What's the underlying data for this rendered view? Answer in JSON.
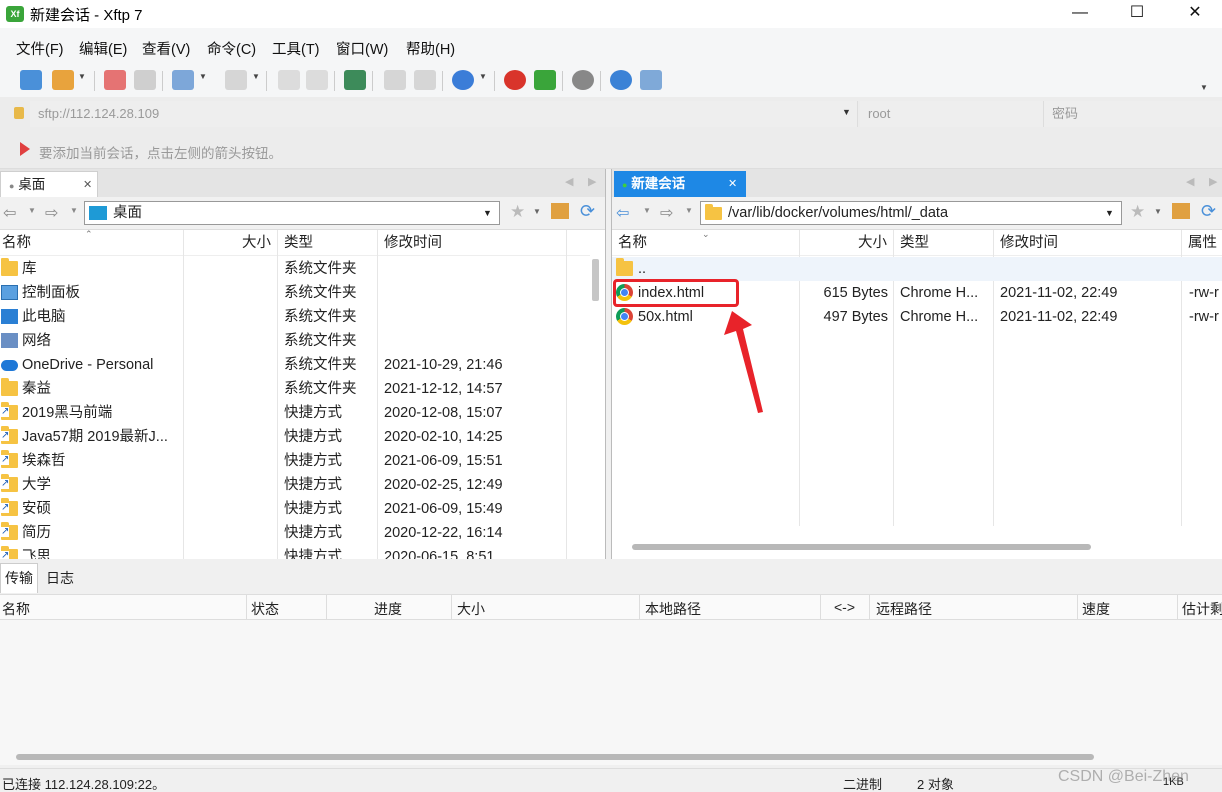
{
  "window": {
    "title": "新建会话 - Xftp 7",
    "app_icon_text": "Xf",
    "min_glyph": "—",
    "max_glyph": "☐",
    "close_glyph": "✕"
  },
  "menu": [
    {
      "label": "文件(F)"
    },
    {
      "label": "编辑(E)"
    },
    {
      "label": "查看(V)"
    },
    {
      "label": "命令(C)"
    },
    {
      "label": "工具(T)"
    },
    {
      "label": "窗口(W)"
    },
    {
      "label": "帮助(H)"
    }
  ],
  "address": {
    "host_placeholder": "sftp://112.124.28.109",
    "user_placeholder": "root",
    "password_placeholder": "密码"
  },
  "hint": "要添加当前会话，点击左侧的箭头按钮。",
  "left_pane": {
    "tab_label": "桌面",
    "path": "桌面",
    "columns": {
      "name": "名称",
      "size": "大小",
      "type": "类型",
      "modified": "修改时间"
    },
    "rows": [
      {
        "name": "库",
        "size": "",
        "type": "系统文件夹",
        "modified": "",
        "icon": "library-folder-icon"
      },
      {
        "name": "控制面板",
        "size": "",
        "type": "系统文件夹",
        "modified": "",
        "icon": "control-panel-icon"
      },
      {
        "name": "此电脑",
        "size": "",
        "type": "系统文件夹",
        "modified": "",
        "icon": "computer-icon"
      },
      {
        "name": "网络",
        "size": "",
        "type": "系统文件夹",
        "modified": "",
        "icon": "network-icon"
      },
      {
        "name": "OneDrive - Personal",
        "size": "",
        "type": "系统文件夹",
        "modified": "2021-10-29, 21:46",
        "icon": "onedrive-cloud-icon"
      },
      {
        "name": "秦益",
        "size": "",
        "type": "系统文件夹",
        "modified": "2021-12-12, 14:57",
        "icon": "folder-icon"
      },
      {
        "name": "2019黑马前端",
        "size": "",
        "type": "快捷方式",
        "modified": "2020-12-08, 15:07",
        "icon": "shortcut-folder-icon"
      },
      {
        "name": "Java57期 2019最新J...",
        "size": "",
        "type": "快捷方式",
        "modified": "2020-02-10, 14:25",
        "icon": "shortcut-folder-icon"
      },
      {
        "name": "埃森哲",
        "size": "",
        "type": "快捷方式",
        "modified": "2021-06-09, 15:51",
        "icon": "shortcut-folder-icon"
      },
      {
        "name": "大学",
        "size": "",
        "type": "快捷方式",
        "modified": "2020-02-25, 12:49",
        "icon": "shortcut-folder-icon"
      },
      {
        "name": "安硕",
        "size": "",
        "type": "快捷方式",
        "modified": "2021-06-09, 15:49",
        "icon": "shortcut-folder-icon"
      },
      {
        "name": "简历",
        "size": "",
        "type": "快捷方式",
        "modified": "2020-12-22, 16:14",
        "icon": "shortcut-folder-icon"
      },
      {
        "name": "飞思",
        "size": "",
        "type": "快捷方式",
        "modified": "2020-06-15, 8:51",
        "icon": "shortcut-folder-icon"
      }
    ]
  },
  "right_pane": {
    "tab_label": "新建会话",
    "path": "/var/lib/docker/volumes/html/_data",
    "columns": {
      "name": "名称",
      "size": "大小",
      "type": "类型",
      "modified": "修改时间",
      "attr": "属性"
    },
    "rows": [
      {
        "name": "..",
        "size": "",
        "type": "",
        "modified": "",
        "attr": "",
        "icon": "parent-folder-icon"
      },
      {
        "name": "index.html",
        "size": "615 Bytes",
        "type": "Chrome H...",
        "modified": "2021-11-02, 22:49",
        "attr": "-rw-r",
        "icon": "chrome-html-icon",
        "highlighted": true
      },
      {
        "name": "50x.html",
        "size": "497 Bytes",
        "type": "Chrome H...",
        "modified": "2021-11-02, 22:49",
        "attr": "-rw-r",
        "icon": "chrome-html-icon"
      }
    ],
    "annotation_color": "#e8232a"
  },
  "bottom": {
    "tabs": [
      {
        "label": "传输"
      },
      {
        "label": "日志"
      }
    ],
    "columns": [
      "名称",
      "状态",
      "进度",
      "大小",
      "本地路径",
      "<->",
      "远程路径",
      "速度",
      "估计剩"
    ]
  },
  "status": {
    "connection": "已连接 112.124.28.109:22。",
    "mode": "二进制",
    "objects": "2 对象",
    "size": "1KB",
    "watermark": "CSDN @Bei-Zhen"
  },
  "colors": {
    "accent": "#1e88e5",
    "tab_active": "#1e90ff"
  }
}
